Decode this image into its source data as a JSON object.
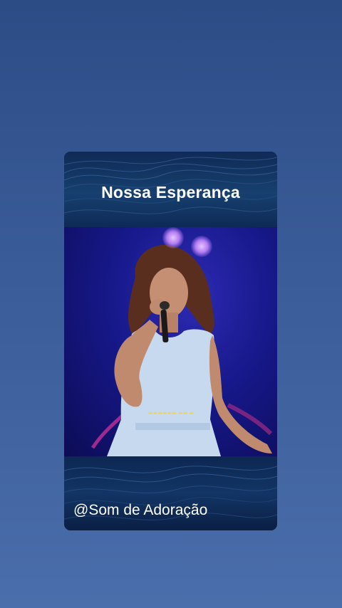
{
  "card": {
    "title": "Nossa Esperança",
    "handle": "@Som de Adoração"
  },
  "video": {
    "description_icon": "singer-performance"
  },
  "colors": {
    "background_top": "#2c4c86",
    "background_bottom": "#4a6eab",
    "card_bg": "#0b1f45",
    "title_text": "#ffffff"
  }
}
